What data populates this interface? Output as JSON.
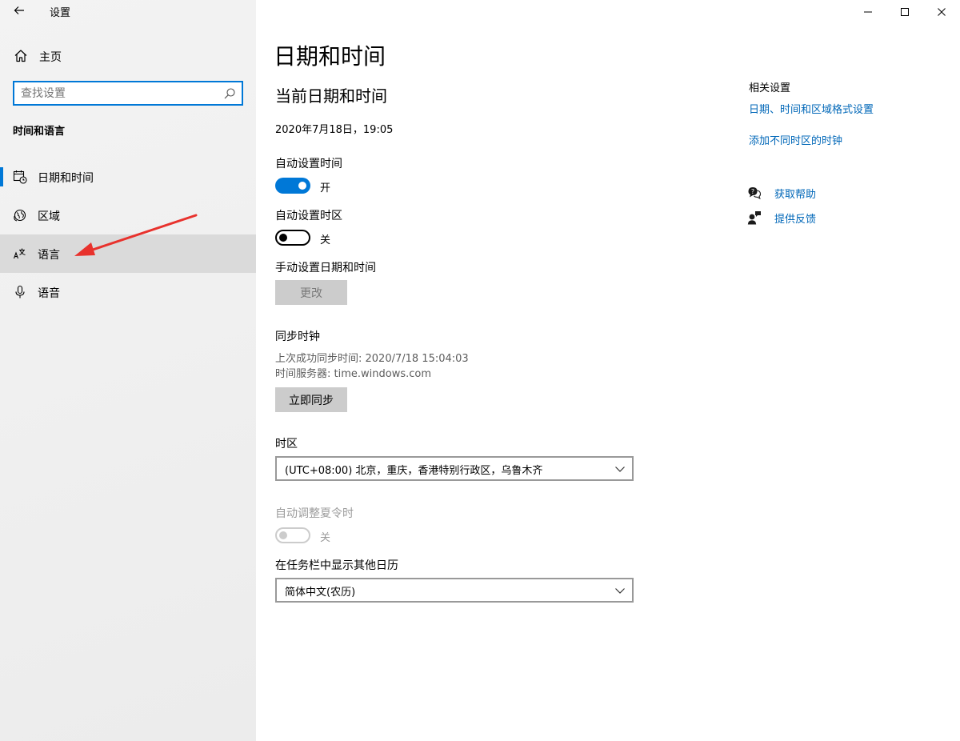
{
  "window": {
    "title": "设置",
    "back_icon": "back-arrow-icon"
  },
  "sidebar": {
    "home": {
      "label": "主页",
      "icon": "home-icon"
    },
    "search": {
      "placeholder": "查找设置",
      "value": "",
      "icon": "search-icon"
    },
    "group_title": "时间和语言",
    "items": [
      {
        "label": "日期和时间",
        "icon": "calendar-clock-icon",
        "active": true
      },
      {
        "label": "区域",
        "icon": "globe-icon"
      },
      {
        "label": "语言",
        "icon": "language-icon",
        "hovered": true
      },
      {
        "label": "语音",
        "icon": "microphone-icon"
      }
    ]
  },
  "main": {
    "page_title": "日期和时间",
    "section_title": "当前日期和时间",
    "current_datetime": "2020年7月18日，19:05",
    "auto_time": {
      "label": "自动设置时间",
      "state": "开",
      "on": true
    },
    "auto_timezone": {
      "label": "自动设置时区",
      "state": "关",
      "on": false
    },
    "manual": {
      "label": "手动设置日期和时间",
      "button": "更改",
      "enabled": false
    },
    "sync": {
      "title": "同步时钟",
      "last_sync": "上次成功同步时间: 2020/7/18 15:04:03",
      "server": "时间服务器: time.windows.com",
      "button": "立即同步"
    },
    "timezone": {
      "label": "时区",
      "value": "(UTC+08:00) 北京，重庆，香港特别行政区，乌鲁木齐"
    },
    "dst": {
      "label": "自动调整夏令时",
      "state": "关",
      "on": false,
      "enabled": false
    },
    "calendar": {
      "label": "在任务栏中显示其他日历",
      "value": "简体中文(农历)"
    }
  },
  "related": {
    "title": "相关设置",
    "links": [
      "日期、时间和区域格式设置",
      "添加不同时区的时钟"
    ],
    "help": {
      "label": "获取帮助",
      "icon": "help-chat-icon"
    },
    "feedback": {
      "label": "提供反馈",
      "icon": "feedback-person-icon"
    }
  },
  "caption_buttons": [
    "minimize-icon",
    "maximize-icon",
    "close-icon"
  ],
  "colors": {
    "accent": "#0078d7",
    "link": "#0067b8",
    "annotation_arrow": "#e8322d"
  }
}
